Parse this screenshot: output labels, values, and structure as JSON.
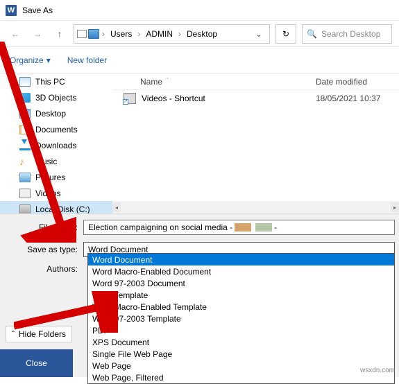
{
  "title": "Save As",
  "nav": {
    "path": [
      "Users",
      "ADMIN",
      "Desktop"
    ],
    "search_placeholder": "Search Desktop"
  },
  "toolbar": {
    "organize": "Organize",
    "new_folder": "New folder"
  },
  "sidebar": {
    "items": [
      {
        "label": "This PC"
      },
      {
        "label": "3D Objects"
      },
      {
        "label": "Desktop"
      },
      {
        "label": "Documents"
      },
      {
        "label": "Downloads"
      },
      {
        "label": "Music"
      },
      {
        "label": "Pictures"
      },
      {
        "label": "Videos"
      },
      {
        "label": "Local Disk (C:)"
      }
    ]
  },
  "file_header": {
    "name": "Name",
    "date": "Date modified"
  },
  "files": [
    {
      "name": "Videos - Shortcut",
      "date": "18/05/2021 10:37"
    }
  ],
  "form": {
    "filename_label": "File name:",
    "filename_value": "Election campaigning on social media -",
    "type_label": "Save as type:",
    "type_value": "Word Document",
    "authors_label": "Authors:"
  },
  "type_options": [
    "Word Document",
    "Word Macro-Enabled Document",
    "Word 97-2003 Document",
    "Word Template",
    "Word Macro-Enabled Template",
    "Word 97-2003 Template",
    "PDF",
    "XPS Document",
    "Single File Web Page",
    "Web Page",
    "Web Page, Filtered"
  ],
  "hide_folders": "Hide Folders",
  "close": "Close",
  "watermark": "wsxdn.com"
}
